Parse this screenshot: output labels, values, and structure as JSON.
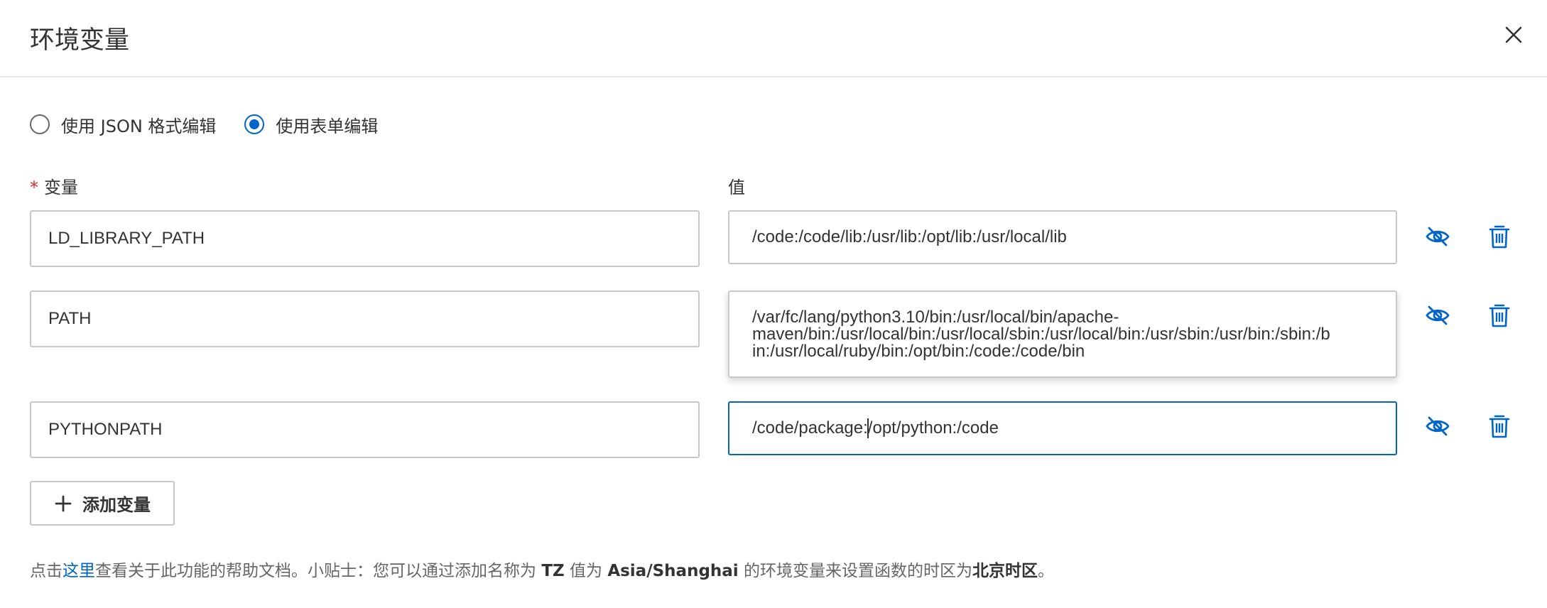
{
  "dialog": {
    "title": "环境变量",
    "close_icon": "close-icon"
  },
  "mode": {
    "options": [
      {
        "label": "使用 JSON 格式编辑",
        "checked": false
      },
      {
        "label": "使用表单编辑",
        "checked": true
      }
    ]
  },
  "columns": {
    "required_mark": "*",
    "variable_label": "变量",
    "value_label": "值"
  },
  "rows": [
    {
      "name": "LD_LIBRARY_PATH",
      "value": "/code:/code/lib:/usr/lib:/opt/lib:/usr/local/lib",
      "visibility_icon": "eye-off-icon",
      "delete_icon": "trash-icon"
    },
    {
      "name": "PATH",
      "value_lines": [
        "/var/fc/lang/python3.10/bin:/usr/local/bin/apache-",
        "maven/bin:/usr/local/bin:/usr/local/sbin:/usr/local/bin:/usr/sbin:/usr/bin:/sbin:/b",
        "in:/usr/local/ruby/bin:/opt/bin:/code:/code/bin"
      ],
      "visibility_icon": "eye-off-icon",
      "delete_icon": "trash-icon"
    },
    {
      "name": "PYTHONPATH",
      "value_before_caret": "/code/package:",
      "value_after_caret": "/opt/python:/code",
      "visibility_icon": "eye-off-icon",
      "delete_icon": "trash-icon"
    }
  ],
  "add_button": {
    "label": "添加变量",
    "icon": "plus-icon"
  },
  "help": {
    "prefix": "点击",
    "link": "这里",
    "text1": "查看关于此功能的帮助文档。小贴士：您可以通过添加名称为 ",
    "tz": "TZ",
    "text2": " 值为 ",
    "tz_value": "Asia/Shanghai",
    "text3": " 的环境变量来设置函数的时区为",
    "zone": "北京时区",
    "suffix": "。"
  },
  "colors": {
    "accent": "#0064c8",
    "required": "#d93026",
    "border": "#c8c8c8"
  }
}
